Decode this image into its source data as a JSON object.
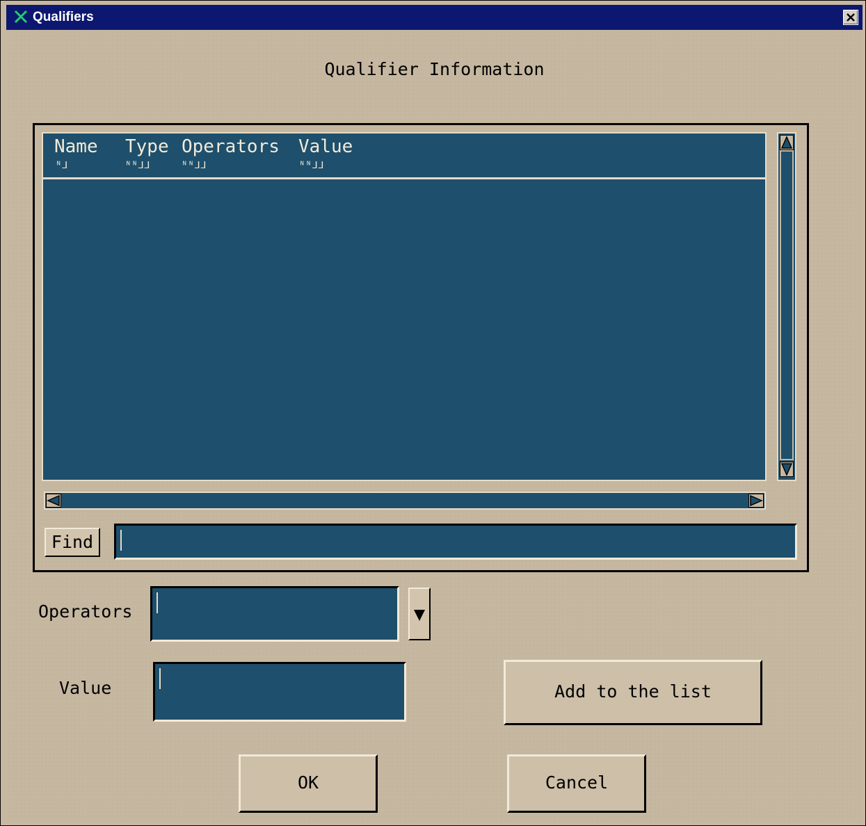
{
  "window": {
    "title": "Qualifiers"
  },
  "dialog": {
    "heading": "Qualifier Information"
  },
  "list": {
    "columns": [
      {
        "label": "Name",
        "mark": "ᴺ⅃"
      },
      {
        "label": "Type",
        "mark": "ᴺᴺ⅃⅃"
      },
      {
        "label": "Operators",
        "mark": "ᴺᴺ⅃⅃"
      },
      {
        "label": "Value",
        "mark": "ᴺᴺ⅃⅃"
      }
    ],
    "rows": []
  },
  "find": {
    "button_label": "Find",
    "value": ""
  },
  "form": {
    "operators_label": "Operators",
    "operators_value": "",
    "value_label": "Value",
    "value_value": ""
  },
  "buttons": {
    "add": "Add to the list",
    "ok": "OK",
    "cancel": "Cancel"
  },
  "icons": {
    "app": "x-logo-icon",
    "close": "close-icon",
    "dropdown": "chevron-down-icon",
    "scroll_up": "arrow-up-icon",
    "scroll_down": "arrow-down-icon",
    "scroll_left": "arrow-left-icon",
    "scroll_right": "arrow-right-icon"
  },
  "colors": {
    "titlebar": "#0c1870",
    "panel": "#c6b7a1",
    "field": "#1e4f6c",
    "field_text": "#f2ead8"
  }
}
